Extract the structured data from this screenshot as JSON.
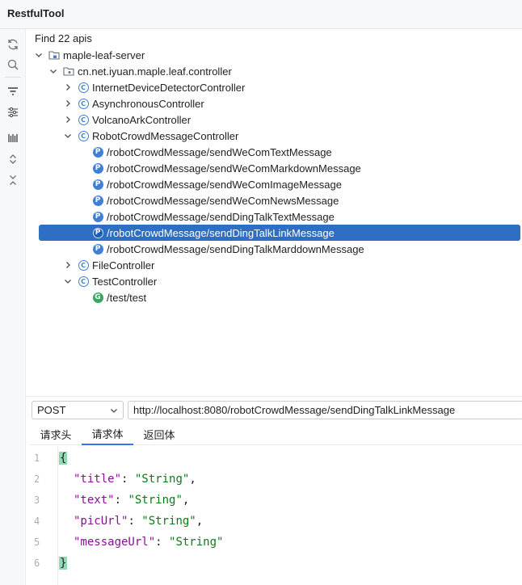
{
  "app": {
    "title": "RestfulTool"
  },
  "toolbar": {
    "tools": [
      {
        "icon": "refresh-icon"
      },
      {
        "icon": "search-icon"
      },
      {
        "icon": "filter-icon"
      },
      {
        "icon": "settings-sliders-icon"
      },
      {
        "icon": "barcode-icon"
      },
      {
        "icon": "expand-all-icon"
      },
      {
        "icon": "collapse-all-icon"
      }
    ]
  },
  "tree": {
    "found_text": "Find 22 apis",
    "module": "maple-leaf-server",
    "package": "cn.net.iyuan.maple.leaf.controller",
    "controllers": [
      {
        "name": "InternetDeviceDetectorController",
        "expanded": false
      },
      {
        "name": "AsynchronousController",
        "expanded": false
      },
      {
        "name": "VolcanoArkController",
        "expanded": false
      },
      {
        "name": "RobotCrowdMessageController",
        "expanded": true,
        "apis": [
          {
            "method_badge": "P",
            "path": "/robotCrowdMessage/sendWeComTextMessage",
            "selected": false
          },
          {
            "method_badge": "P",
            "path": "/robotCrowdMessage/sendWeComMarkdownMessage",
            "selected": false
          },
          {
            "method_badge": "P",
            "path": "/robotCrowdMessage/sendWeComImageMessage",
            "selected": false
          },
          {
            "method_badge": "P",
            "path": "/robotCrowdMessage/sendWeComNewsMessage",
            "selected": false
          },
          {
            "method_badge": "P",
            "path": "/robotCrowdMessage/sendDingTalkTextMessage",
            "selected": false
          },
          {
            "method_badge": "P",
            "path": "/robotCrowdMessage/sendDingTalkLinkMessage",
            "selected": true
          },
          {
            "method_badge": "P",
            "path": "/robotCrowdMessage/sendDingTalkMarddownMessage",
            "selected": false
          }
        ]
      },
      {
        "name": "FileController",
        "expanded": false
      },
      {
        "name": "TestController",
        "expanded": true,
        "apis": [
          {
            "method_badge": "G",
            "path": "/test/test",
            "selected": false
          }
        ]
      }
    ]
  },
  "request": {
    "method": "POST",
    "url": "http://localhost:8080/robotCrowdMessage/sendDingTalkLinkMessage",
    "tabs": [
      {
        "label": "请求头",
        "active": false
      },
      {
        "label": "请求体",
        "active": true
      },
      {
        "label": "返回体",
        "active": false
      }
    ],
    "body_lines": [
      "1",
      "2",
      "3",
      "4",
      "5",
      "6"
    ],
    "body": {
      "open": "{",
      "close": "}",
      "fields": [
        {
          "key": "\"title\"",
          "sep": ": ",
          "value": "\"String\"",
          "comma": ","
        },
        {
          "key": "\"text\"",
          "sep": ": ",
          "value": "\"String\"",
          "comma": ","
        },
        {
          "key": "\"picUrl\"",
          "sep": ": ",
          "value": "\"String\"",
          "comma": ","
        },
        {
          "key": "\"messageUrl\"",
          "sep": ": ",
          "value": "\"String\"",
          "comma": ""
        }
      ]
    }
  },
  "colors": {
    "selection": "#2e6fc4",
    "accent": "#3574f0",
    "json_key": "#871094",
    "json_string": "#067d17",
    "brace_highlight": "#93d9b3"
  }
}
